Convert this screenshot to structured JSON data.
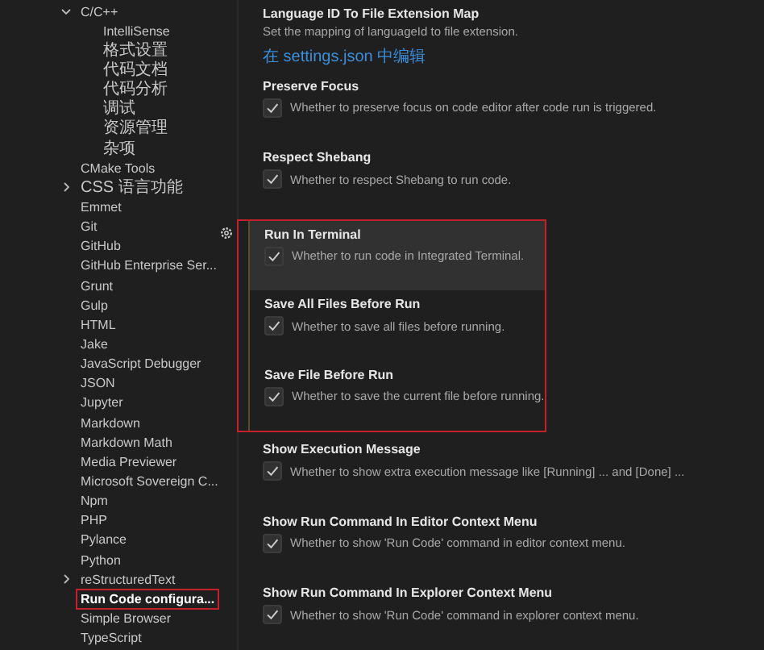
{
  "sidebar": {
    "items": [
      {
        "label": "C/C++",
        "expanded": true,
        "selected": false,
        "children": [
          {
            "label": "IntelliSense"
          },
          {
            "label": "格式设置"
          },
          {
            "label": "代码文档"
          },
          {
            "label": "代码分析"
          },
          {
            "label": "调试"
          },
          {
            "label": "资源管理"
          },
          {
            "label": "杂项"
          }
        ]
      },
      {
        "label": "CMake Tools",
        "selected": false
      },
      {
        "label": "CSS 语言功能",
        "expanded": false,
        "selected": false
      },
      {
        "label": "Emmet",
        "selected": false
      },
      {
        "label": "Git",
        "selected": false
      },
      {
        "label": "GitHub",
        "selected": false
      },
      {
        "label": "GitHub Enterprise Ser...",
        "selected": false
      },
      {
        "label": "Grunt",
        "selected": false
      },
      {
        "label": "Gulp",
        "selected": false
      },
      {
        "label": "HTML",
        "selected": false
      },
      {
        "label": "Jake",
        "selected": false
      },
      {
        "label": "JavaScript Debugger",
        "selected": false
      },
      {
        "label": "JSON",
        "selected": false
      },
      {
        "label": "Jupyter",
        "selected": false
      },
      {
        "label": "Markdown",
        "selected": false
      },
      {
        "label": "Markdown Math",
        "selected": false
      },
      {
        "label": "Media Previewer",
        "selected": false
      },
      {
        "label": "Microsoft Sovereign C...",
        "selected": false
      },
      {
        "label": "Npm",
        "selected": false
      },
      {
        "label": "PHP",
        "selected": false
      },
      {
        "label": "Pylance",
        "selected": false
      },
      {
        "label": "Python",
        "selected": false
      },
      {
        "label": "reStructuredText",
        "expanded": false,
        "selected": false
      },
      {
        "label": "Run Code configura...",
        "selected": true
      },
      {
        "label": "Simple Browser",
        "selected": false
      },
      {
        "label": "TypeScript",
        "selected": false
      }
    ]
  },
  "settings": [
    {
      "kind": "link",
      "title": "Language ID To File Extension Map",
      "description": "Set the mapping of languageId to file extension.",
      "link": "在 settings.json 中编辑",
      "focused": false,
      "highlighted": false
    },
    {
      "kind": "checkbox",
      "title": "Preserve Focus",
      "description": "Whether to preserve focus on code editor after code run is triggered.",
      "checked": true,
      "focused": false,
      "highlighted": false
    },
    {
      "kind": "checkbox",
      "title": "Respect Shebang",
      "description": "Whether to respect Shebang to run code.",
      "checked": true,
      "focused": false,
      "highlighted": false
    },
    {
      "kind": "checkbox",
      "title": "Run In Terminal",
      "description": "Whether to run code in Integrated Terminal.",
      "checked": true,
      "focused": true,
      "highlighted": true
    },
    {
      "kind": "checkbox",
      "title": "Save All Files Before Run",
      "description": "Whether to save all files before running.",
      "checked": true,
      "focused": false,
      "highlighted": true
    },
    {
      "kind": "checkbox",
      "title": "Save File Before Run",
      "description": "Whether to save the current file before running.",
      "checked": true,
      "focused": false,
      "highlighted": true
    },
    {
      "kind": "checkbox",
      "title": "Show Execution Message",
      "description": "Whether to show extra execution message like [Running] ... and [Done] ...",
      "checked": true,
      "focused": false,
      "highlighted": false
    },
    {
      "kind": "checkbox",
      "title": "Show Run Command In Editor Context Menu",
      "description": "Whether to show 'Run Code' command in editor context menu.",
      "checked": true,
      "focused": false,
      "highlighted": false
    },
    {
      "kind": "checkbox",
      "title": "Show Run Command In Explorer Context Menu",
      "description": "Whether to show 'Run Code' command in explorer context menu.",
      "checked": true,
      "focused": false,
      "highlighted": false
    }
  ]
}
